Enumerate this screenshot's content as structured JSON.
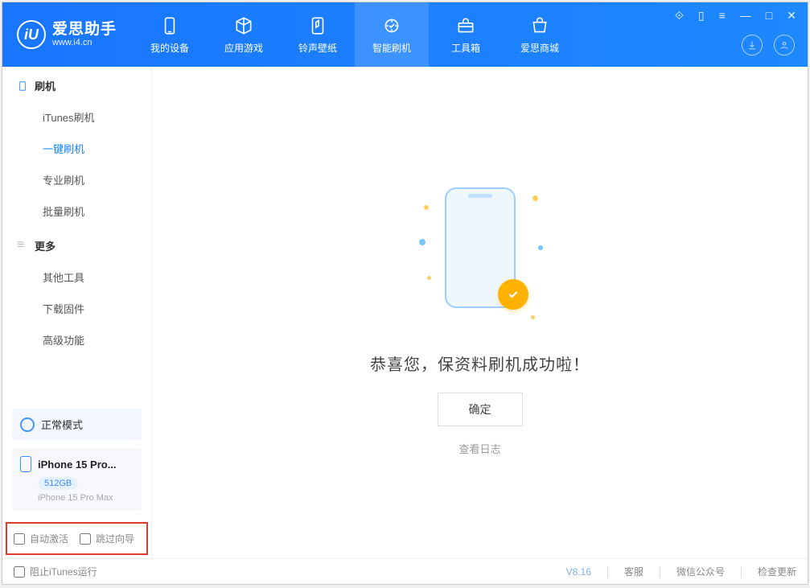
{
  "app": {
    "title": "爱思助手",
    "subtitle": "www.i4.cn"
  },
  "topTabs": [
    {
      "label": "我的设备"
    },
    {
      "label": "应用游戏"
    },
    {
      "label": "铃声壁纸"
    },
    {
      "label": "智能刷机",
      "active": true
    },
    {
      "label": "工具箱"
    },
    {
      "label": "爱思商城"
    }
  ],
  "sidebar": {
    "section1": {
      "title": "刷机",
      "items": [
        "iTunes刷机",
        "一键刷机",
        "专业刷机",
        "批量刷机"
      ],
      "activeIndex": 1
    },
    "section2": {
      "title": "更多",
      "items": [
        "其他工具",
        "下载固件",
        "高级功能"
      ]
    },
    "status": "正常模式",
    "device": {
      "name": "iPhone 15 Pro...",
      "storage": "512GB",
      "model": "iPhone 15 Pro Max"
    },
    "options": {
      "autoActivate": "自动激活",
      "skipGuide": "跳过向导"
    }
  },
  "main": {
    "successMsg": "恭喜您，保资料刷机成功啦！",
    "okButton": "确定",
    "viewLog": "查看日志"
  },
  "footer": {
    "blockItunes": "阻止iTunes运行",
    "version": "V8.16",
    "links": [
      "客服",
      "微信公众号",
      "检查更新"
    ]
  }
}
